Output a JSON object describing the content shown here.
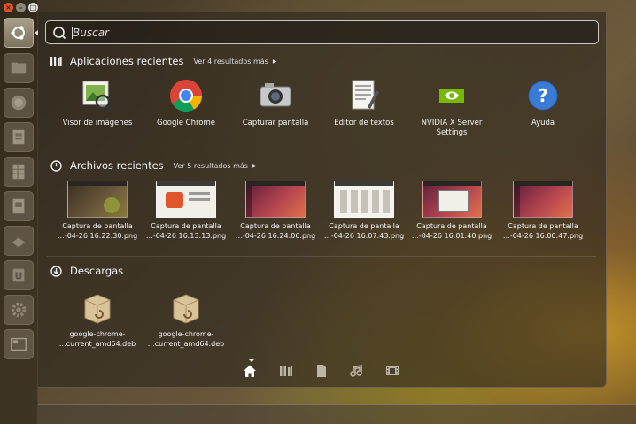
{
  "search": {
    "placeholder": "Buscar"
  },
  "applications": {
    "title": "Aplicaciones recientes",
    "more": "Ver 4 resultados más",
    "items": [
      {
        "label": "Visor de imágenes",
        "icon": "image-viewer-icon"
      },
      {
        "label": "Google Chrome",
        "icon": "chrome-icon"
      },
      {
        "label": "Capturar pantalla",
        "icon": "camera-icon"
      },
      {
        "label": "Editor de textos",
        "icon": "text-editor-icon"
      },
      {
        "label": "NVIDIA X Server Settings",
        "icon": "nvidia-icon"
      },
      {
        "label": "Ayuda",
        "icon": "help-icon"
      }
    ]
  },
  "files": {
    "title": "Archivos recientes",
    "more": "Ver 5 resultados más",
    "items": [
      {
        "line1": "Captura de pantalla",
        "line2": "…-04-26 16:22:30.png"
      },
      {
        "line1": "Captura de pantalla",
        "line2": "…-04-26 16:13:13.png"
      },
      {
        "line1": "Captura de pantalla",
        "line2": "…-04-26 16:24:06.png"
      },
      {
        "line1": "Captura de pantalla",
        "line2": "…-04-26 16:07:43.png"
      },
      {
        "line1": "Captura de pantalla",
        "line2": "…-04-26 16:01:40.png"
      },
      {
        "line1": "Captura de pantalla",
        "line2": "…-04-26 16:00:47.png"
      }
    ]
  },
  "downloads": {
    "title": "Descargas",
    "items": [
      {
        "line1": "google-chrome-",
        "line2": "…current_amd64.deb"
      },
      {
        "line1": "google-chrome-",
        "line2": "…current_amd64.deb"
      }
    ]
  },
  "filters": [
    "home",
    "applications",
    "files",
    "music",
    "video"
  ],
  "colors": {
    "accent": "#e0552c",
    "panel": "#2d261e"
  }
}
